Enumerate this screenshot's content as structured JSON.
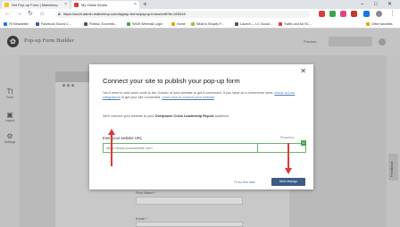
{
  "browser": {
    "tabs": [
      {
        "title": "Set Pop-up Form | Mailchimp",
        "favicon_color": "#f5c518"
      },
      {
        "title": "My Oasis Studio",
        "favicon_color": "#d93b3b"
      }
    ],
    "new_tab_icon": "plus-icon",
    "window_controls": [
      "minimize-icon",
      "maximize-icon",
      "close-icon"
    ],
    "url": "https://us18.admin.mailchimp.com/signup-forms/popup-forms/edit?id=403449",
    "extension_colors": [
      "#d93b3b",
      "#3fa34d",
      "#e0457b",
      "#c0392b",
      "#1a73e8",
      "#555555",
      "#555555"
    ],
    "bookmarks": [
      {
        "label": "Fit Newsletter",
        "color": "#1a73e8"
      },
      {
        "label": "Facebook Sound C...",
        "color": "#3b5998"
      },
      {
        "label": "Fintess, Eccentric...",
        "color": "#555555"
      },
      {
        "label": "WSW Webmail Login",
        "color": "#3fa34d"
      },
      {
        "label": "Home",
        "color": "#e0a800"
      },
      {
        "label": "What is Shopify F...",
        "color": "#96bf48"
      },
      {
        "label": "Launch — LC Social...",
        "color": "#555555"
      },
      {
        "label": "Traffic and Ad SC...",
        "color": "#d93b3b"
      },
      {
        "label": "Other favorites",
        "color": "#e0a800"
      }
    ]
  },
  "app": {
    "title": "Pop-up Form Builder",
    "preview_label": "Preview",
    "sidebar": [
      {
        "label": "Tools",
        "icon": "type-icon"
      },
      {
        "label": "Layout",
        "icon": "layout-icon"
      },
      {
        "label": "Settings",
        "icon": "gear-icon"
      }
    ],
    "form_fields": [
      {
        "label": "First Name *"
      },
      {
        "label": "Email *"
      }
    ],
    "feedback_label": "Feedback"
  },
  "modal": {
    "title": "Connect your site to publish your pop-up form",
    "para1_a": "You'll need to add some code to the ",
    "para1_b": " of your website to get it connected. If you have an e-commerce store, ",
    "para1_link1": "check out our integrations",
    "para1_c": " to get your site connected. ",
    "para1_link2": "Learn how to connect your website",
    "para1_tag": "<head>",
    "para2_a": "We'll connect your website to your ",
    "para2_bold": "Overpower Crisis Leadership Report",
    "para2_c": " audience.",
    "url_label": "Enter your website URL",
    "required_label": "Required",
    "url_placeholder": "https://www.yourwebsite.com",
    "do_later_label": "I'll do this later",
    "next_label": "Next step/go",
    "close_icon": "close-icon"
  },
  "colors": {
    "primary_button": "#3d5c84",
    "link": "#4a7eb3",
    "annotation": "#d93b3b",
    "input_focus": "#6db36d"
  }
}
